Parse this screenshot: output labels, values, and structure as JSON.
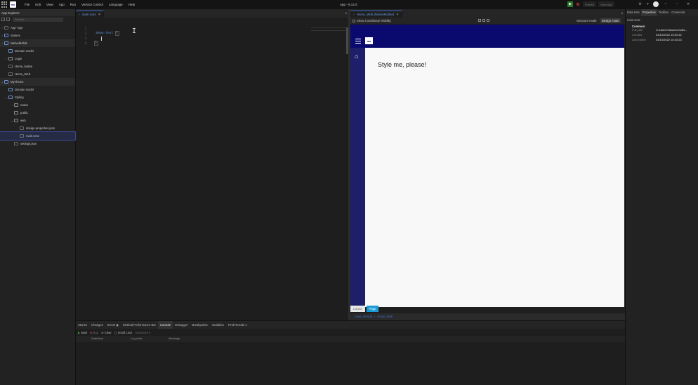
{
  "titlebar": {
    "menu": [
      "File",
      "Edit",
      "View",
      "App",
      "Run",
      "Version Control",
      "Language",
      "Help"
    ],
    "app_title": "App - 9.12.0",
    "publish_label": "Publish",
    "view_app_label": "View App",
    "logo_text": "mx"
  },
  "explorer": {
    "title": "App Explorer",
    "search_placeholder": "Search...",
    "items": [
      {
        "label": "App 'App'"
      },
      {
        "label": "System"
      },
      {
        "label": "NativeMobile"
      },
      {
        "label": "Domain model"
      },
      {
        "label": "Login"
      },
      {
        "label": "Home_Native"
      },
      {
        "label": "Home_Web"
      },
      {
        "label": "MyTheme"
      },
      {
        "label": "Domain model"
      },
      {
        "label": "Styling"
      },
      {
        "label": "native"
      },
      {
        "label": "public"
      },
      {
        "label": "web"
      },
      {
        "label": "design-properties.json"
      },
      {
        "label": "main.scss"
      },
      {
        "label": "settings.json"
      }
    ]
  },
  "editor": {
    "tab_label": "main.scss",
    "line_numbers": [
      "1",
      "2",
      "3",
      "4"
    ],
    "line2_selector": ".demo-text",
    "line2_brace": "{",
    "line4_brace": "}"
  },
  "page_editor": {
    "tab_label": "Home_Web [NativeMobile]",
    "show_visibility": "Show Conditional Visibility",
    "structure_mode": "Structure mode",
    "design_mode": "Design mode",
    "logo_text": "mx",
    "page_text": "Style me, please!",
    "crumb_layout": "Layout",
    "crumb_page": "Page",
    "status_atlas": "Atlas_Default",
    "status_page": "Home_Web"
  },
  "right_panel": {
    "tabs": [
      "Data Hub",
      "Properties",
      "Toolbox",
      "Connector"
    ],
    "subtitle": "main.scss",
    "section": "Common",
    "props": [
      {
        "key": "Full path",
        "value": "C:\\Users\\Takuma.Gotts..."
      },
      {
        "key": "Created",
        "value": "03/10/2022 15:51:52"
      },
      {
        "key": "Last edited",
        "value": "03/10/2022 16:10:23"
      }
    ]
  },
  "bottom": {
    "tabs": [
      "Stories",
      "Changes",
      "Errors",
      "Method Performance Bot",
      "Console",
      "Debugger",
      "Breakpoints",
      "Variables",
      "Find Results 1"
    ],
    "errors_count": "0",
    "start_label": "Start",
    "stop_label": "Stop",
    "clear_label": "Clear",
    "scroll_lock_label": "Scroll Lock",
    "advanced_label": "Advanced",
    "columns": [
      "Date/time",
      "Log node",
      "Message"
    ]
  }
}
